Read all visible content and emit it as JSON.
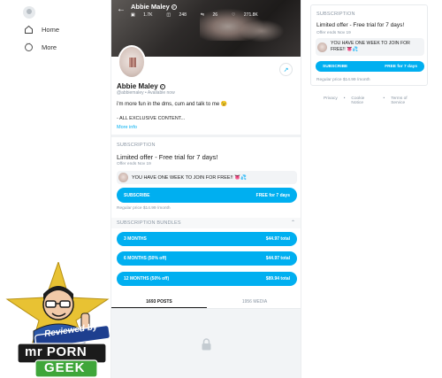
{
  "nav": {
    "items": [
      {
        "label": "Home"
      },
      {
        "label": "More"
      }
    ]
  },
  "cover": {
    "name": "Abbie Maley",
    "stats": [
      "1.7K",
      "248",
      "26",
      "271.8K"
    ]
  },
  "profile": {
    "name": "Abbie Maley",
    "handle": "@abbiemaley",
    "status": "Available now",
    "bio_line1": "i'm more fun in the dms, cum and talk to me 😉",
    "bio_line2": "- ALL EXCLUSIVE CONTENT...",
    "more_info": "More info"
  },
  "subscription": {
    "label": "SUBSCRIPTION",
    "offer_title": "Limited offer - Free trial for 7 days!",
    "offer_ends": "Offer ends Nov 19",
    "message": "YOU HAVE ONE WEEK TO JOIN FOR FREE!! 👅💦",
    "button_label": "SUBSCRIBE",
    "button_price": "FREE for 7 days",
    "regular_price": "Regular price $14.99 /month"
  },
  "bundles": {
    "label": "SUBSCRIPTION BUNDLES",
    "items": [
      {
        "label": "3 MONTHS",
        "price": "$44.97 total"
      },
      {
        "label": "6 MONTHS (50% off)",
        "price": "$44.97 total"
      },
      {
        "label": "12 MONTHS (50% off)",
        "price": "$89.94 total"
      }
    ]
  },
  "tabs": [
    {
      "label": "1693 POSTS"
    },
    {
      "label": "1956 MEDIA"
    }
  ],
  "sidebar_offer": {
    "label": "SUBSCRIPTION",
    "offer_title": "Limited offer - Free trial for 7 days!",
    "offer_ends": "Offer ends Nov 19",
    "message": "YOU HAVE ONE WEEK TO JOIN FOR FREE!! 👅💦",
    "button_label": "SUBSCRIBE",
    "button_price": "FREE for 7 days",
    "regular_price": "Regular price $14.99 /month"
  },
  "footer": {
    "links": [
      "Privacy",
      "Cookie Notice",
      "Terms of Service"
    ]
  },
  "watermark": {
    "line1": "Reviewed by",
    "line2": "mr PORN",
    "line3": "GEEK"
  },
  "colors": {
    "accent": "#00aff0",
    "muted": "#8a96a3"
  },
  "icons": {
    "home": "home-icon",
    "more": "more-icon",
    "back": "back-arrow-icon",
    "share": "share-icon",
    "lock": "lock-icon"
  }
}
